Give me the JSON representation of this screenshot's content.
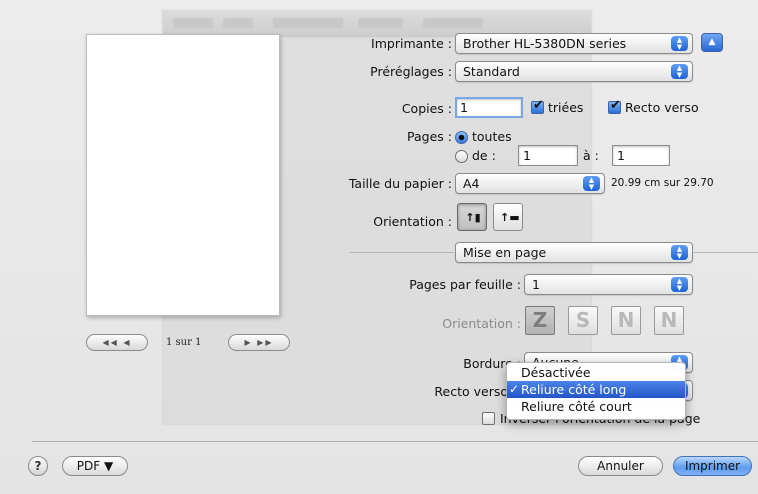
{
  "preview": {
    "first_label": "◀◀ ◀",
    "next_label": "▶ ▶▶",
    "page_count": "1 sur 1"
  },
  "printer": {
    "label": "Imprimante :",
    "value": "Brother HL-5380DN series",
    "toggle_icon": "disclosure-up-icon"
  },
  "presets": {
    "label": "Préréglages :",
    "value": "Standard"
  },
  "copies": {
    "label": "Copies :",
    "value": "1",
    "collated_label": "triées",
    "collated_checked": true,
    "duplex_label": "Recto verso",
    "duplex_checked": true
  },
  "pages": {
    "label": "Pages :",
    "all_label": "toutes",
    "all_selected": true,
    "from_label": "de :",
    "from_value": "1",
    "to_label": "à :",
    "to_value": "1"
  },
  "paper_size": {
    "label": "Taille du papier :",
    "value": "A4",
    "dimensions": "20.99 cm sur 29.70"
  },
  "orientation": {
    "label": "Orientation :",
    "options": [
      "portrait-icon",
      "landscape-icon"
    ],
    "selected": 0
  },
  "section": {
    "value": "Mise en page"
  },
  "layout": {
    "pages_per_sheet_label": "Pages par feuille :",
    "pages_per_sheet_value": "1",
    "orientation_label": "Orientation :",
    "orientation_glyphs": [
      "Z",
      "S",
      "N",
      "N"
    ],
    "orientation_icons": [
      "z-order-icon",
      "reverse-z-order-icon",
      "n-order-icon",
      "reverse-n-order-icon"
    ],
    "orientation_selected": 0,
    "border_label": "Bordure :",
    "border_value": "Aucune",
    "duplex_label": "Recto verso",
    "reverse_label": "Inverser l'orientation de la page",
    "reverse_checked": false
  },
  "duplex_menu": {
    "items": [
      "Désactivée",
      "Reliure côté long",
      "Reliure côté court"
    ],
    "selected": 1,
    "check_glyph": "✓"
  },
  "footer": {
    "help_label": "?",
    "pdf_label": "PDF ▼",
    "cancel_label": "Annuler",
    "print_label": "Imprimer"
  },
  "colors": {
    "accent": "#2e6fdc",
    "selection": "#2355c8"
  }
}
